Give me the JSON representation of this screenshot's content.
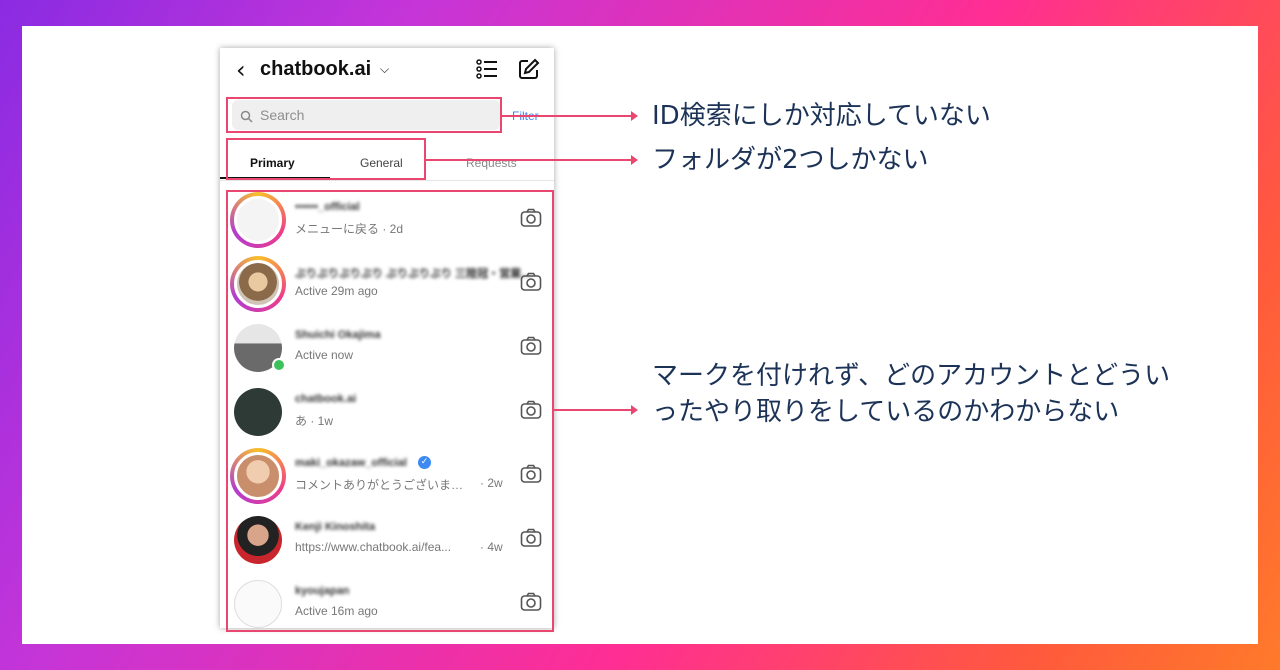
{
  "app": {
    "title": "chatbook.ai",
    "back_icon": "back-chevron-icon",
    "dropdown_icon": "chevron-down-icon"
  },
  "search": {
    "placeholder": "Search",
    "filter_label": "Filter"
  },
  "tabs": [
    {
      "label": "Primary"
    },
    {
      "label": "General"
    },
    {
      "label": "Requests"
    }
  ],
  "threads": [
    {
      "name": "••••••_official",
      "subtitle": "メニューに戻る · 2d",
      "time": ""
    },
    {
      "name": "ぶりぶりぶりぶり ぶりぶりぶり 三陸冠・営業…",
      "subtitle": "Active 29m ago",
      "time": ""
    },
    {
      "name": "Shuichi Okajima",
      "subtitle": "Active now",
      "time": ""
    },
    {
      "name": "chatbook.ai",
      "subtitle": "あ · 1w",
      "time": ""
    },
    {
      "name": "maki_okazaw_official",
      "subtitle": "コメントありがとうございま…",
      "time": "· 2w"
    },
    {
      "name": "Kenji Kinoshita",
      "subtitle": "https://www.chatbook.ai/fea...",
      "time": "· 4w"
    },
    {
      "name": "kyoujapan",
      "subtitle": "Active 16m ago",
      "time": ""
    }
  ],
  "annotations": {
    "search_note": "ID検索にしか対応していない",
    "tabs_note": "フォルダが2つしかない",
    "list_note": "マークを付けれず、どのアカウントとどういったやり取りをしているのかわからない"
  },
  "colors": {
    "highlight": "#e9476f",
    "note_text": "#1c3357",
    "link_blue": "#3b82f6"
  }
}
